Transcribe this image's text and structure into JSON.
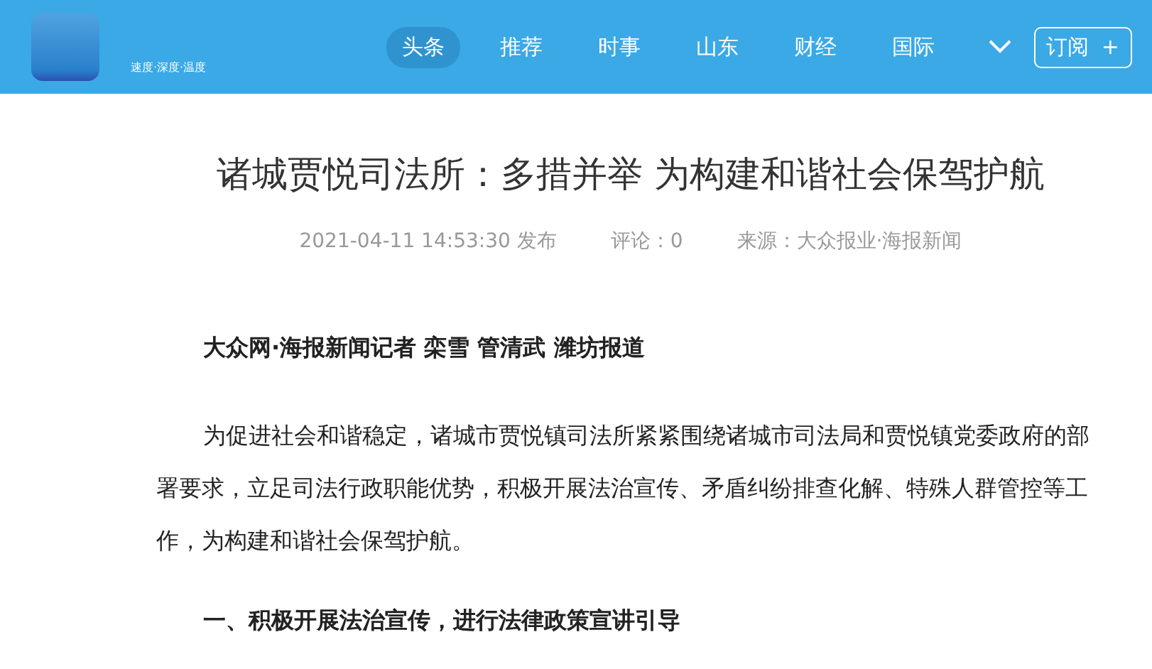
{
  "header": {
    "tagline": "速度·深度·温度",
    "nav": [
      {
        "label": "头条",
        "selected": true
      },
      {
        "label": "推荐",
        "selected": false
      },
      {
        "label": "时事",
        "selected": false
      },
      {
        "label": "山东",
        "selected": false
      },
      {
        "label": "财经",
        "selected": false
      },
      {
        "label": "国际",
        "selected": false
      }
    ],
    "subscribe": {
      "label": "订阅",
      "plus": "+"
    }
  },
  "article": {
    "title": "诸城贾悦司法所：多措并举 为构建和谐社会保驾护航",
    "published": "2021-04-11 14:53:30 发布",
    "comments": "评论：0",
    "source": "来源：大众报业·海报新闻",
    "blocks": [
      {
        "kind": "byline",
        "text": "大众网·海报新闻记者 栾雪 管清武 潍坊报道"
      },
      {
        "kind": "paragraph",
        "text": "为促进社会和谐稳定，诸城市贾悦镇司法所紧紧围绕诸城市司法局和贾悦镇党委政府的部署要求，立足司法行政职能优势，积极开展法治宣传、矛盾纠纷排查化解、特殊人群管控等工作，为构建和谐社会保驾护航。"
      },
      {
        "kind": "heading",
        "text": "一、积极开展法治宣传，进行法律政策宣讲引导"
      }
    ]
  }
}
